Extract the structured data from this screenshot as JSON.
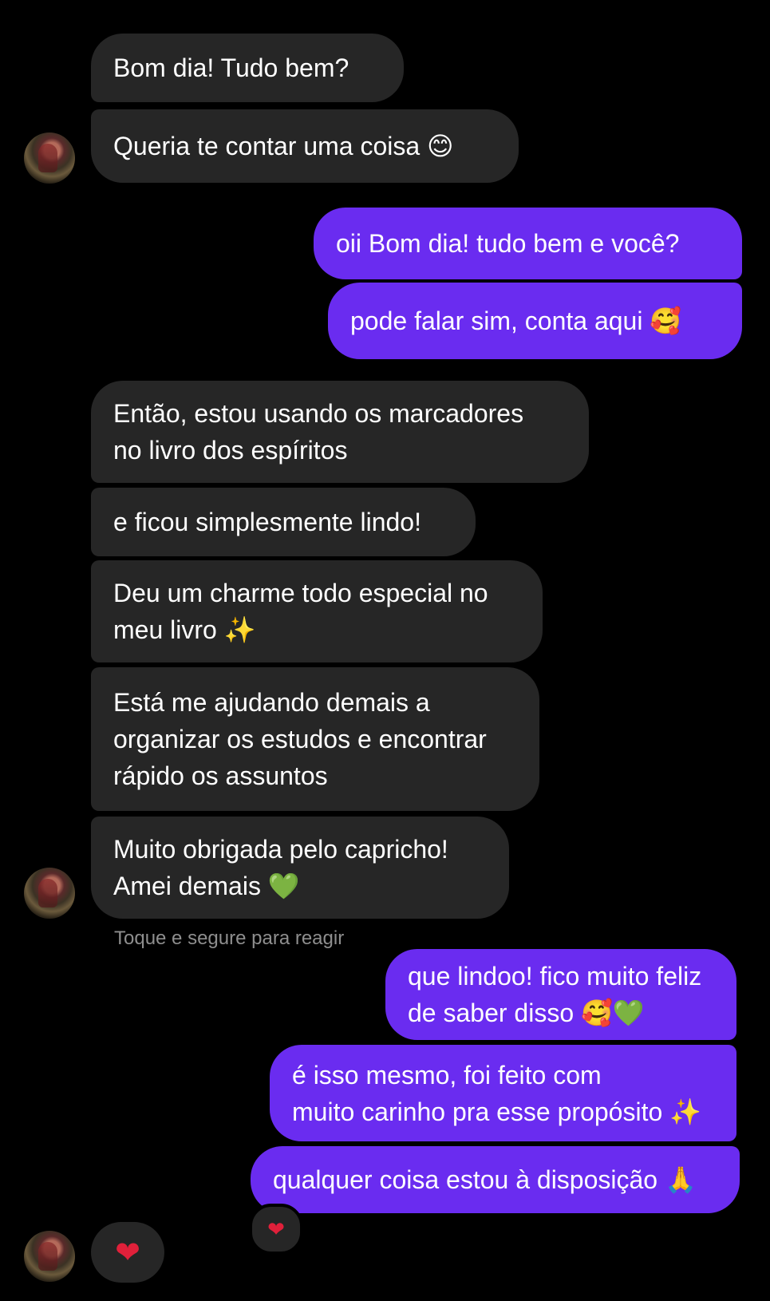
{
  "conversation": {
    "incoming_group_1": [
      "Bom dia! Tudo bem?",
      "Queria te contar uma coisa 😊"
    ],
    "outgoing_group_1": [
      "oii Bom dia! tudo bem e você?",
      "pode falar sim, conta aqui 🥰"
    ],
    "incoming_group_2": [
      "Então, estou usando os marcadores\nno livro dos espíritos",
      "e ficou simplesmente lindo!",
      "Deu um charme todo especial no\nmeu livro ✨",
      "Está me ajudando demais a\norganizar os estudos e encontrar\nrápido os assuntos",
      "Muito obrigada pelo capricho!\nAmei demais 💚"
    ],
    "reaction_hint": "Toque e segure para reagir",
    "outgoing_group_2": [
      "que lindoo! fico muito feliz\nde saber disso 🥰💚",
      "é isso mesmo, foi feito com\nmuito carinho pra esse propósito ✨",
      "qualquer coisa estou à disposição 🙏"
    ],
    "reaction_on_last_outgoing": "❤",
    "incoming_heart": "❤"
  },
  "icons": {
    "avatar": "profile-photo",
    "reaction": "red-heart"
  },
  "colors": {
    "background": "#000000",
    "incoming_bubble": "#262626",
    "outgoing_bubble": "#6a2cf0",
    "hint_text": "#8e8e8e",
    "heart": "#e0203a"
  }
}
